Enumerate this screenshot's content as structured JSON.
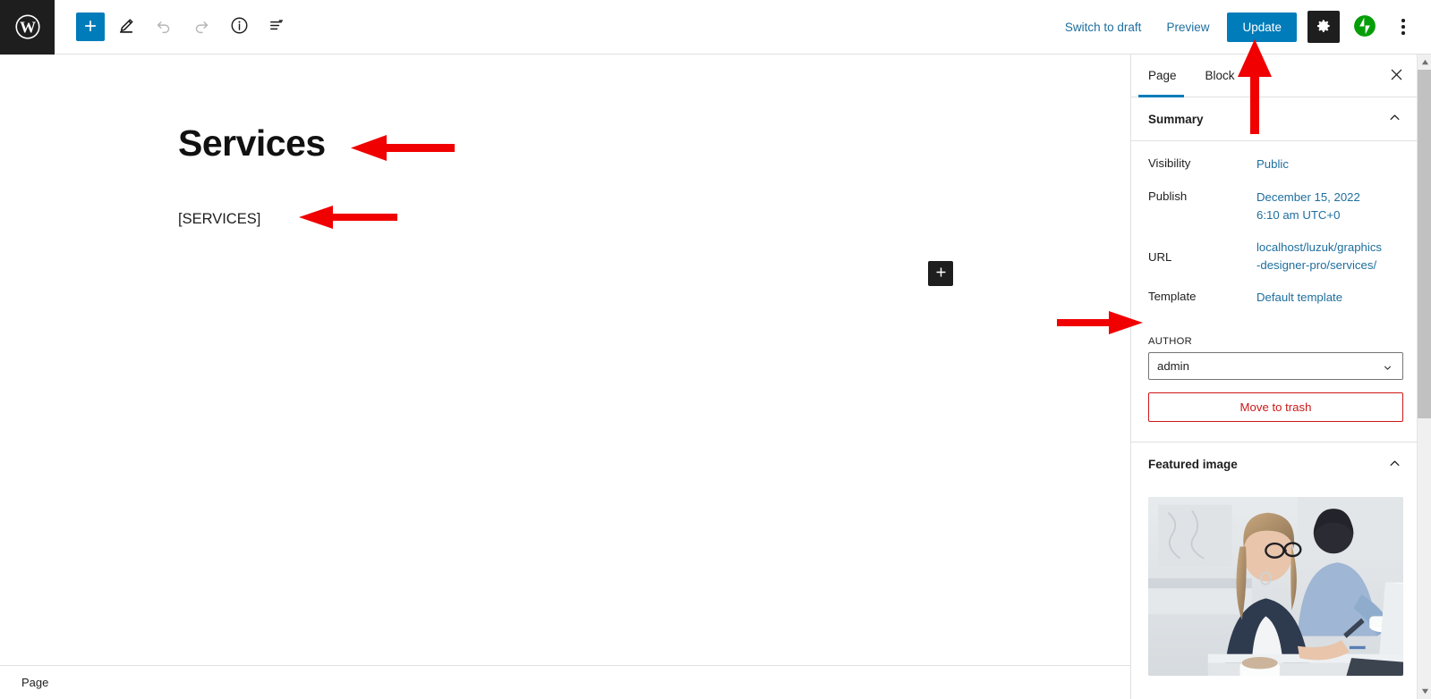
{
  "toolbar": {
    "logo_icon": "wordpress-logo-icon",
    "add_block_label": "+",
    "add_block_icon": "plus-icon",
    "tools_icon": "pencil-edit-icon",
    "undo_icon": "undo-arrow-icon",
    "redo_icon": "redo-arrow-icon",
    "details_icon": "info-circle-icon",
    "list_view_icon": "document-overview-icon",
    "switch_to_draft_label": "Switch to draft",
    "preview_label": "Preview",
    "update_label": "Update",
    "settings_icon": "gear-icon",
    "jetpack_icon": "jetpack-icon",
    "options_icon": "kebab-menu-icon"
  },
  "canvas": {
    "title": "Services",
    "body_text": "[SERVICES]",
    "inserter_icon": "plus-icon"
  },
  "statusbar": {
    "document_type": "Page"
  },
  "sidebar": {
    "tabs": [
      {
        "label": "Page",
        "active": true
      },
      {
        "label": "Block",
        "active": false
      }
    ],
    "close_icon": "close-x-icon",
    "summary": {
      "title": "Summary",
      "collapse_icon": "chevron-up-icon",
      "rows": [
        {
          "key": "Visibility",
          "value": "Public"
        },
        {
          "key": "Publish",
          "value": "December 15, 2022 6:10 am UTC+0"
        },
        {
          "key": "URL",
          "value": "localhost/luzuk/graphics-designer-pro/services/"
        },
        {
          "key": "Template",
          "value": "Default template"
        }
      ],
      "author_label": "AUTHOR",
      "author_value": "admin",
      "author_chevron_icon": "chevron-down-icon",
      "trash_label": "Move to trash"
    },
    "featured_image": {
      "title": "Featured image",
      "collapse_icon": "chevron-up-icon",
      "image_alt": "Two people working at desks with laptops in a bright office"
    },
    "scrollbar": {
      "up_icon": "scroll-up-arrow-icon",
      "down_icon": "scroll-down-arrow-icon"
    }
  },
  "annotations": {
    "color": "#f00000",
    "arrows": [
      {
        "name": "arrow-to-title",
        "direction": "left"
      },
      {
        "name": "arrow-to-body-shortcode",
        "direction": "left"
      },
      {
        "name": "arrow-to-template-row",
        "direction": "right"
      },
      {
        "name": "arrow-to-update-button",
        "direction": "up"
      }
    ]
  },
  "colors": {
    "accent_blue": "#007cba",
    "link_blue": "#1e6e9e",
    "dark": "#1e1e1e",
    "danger_red": "#cc1818",
    "annotation_red": "#f00000"
  }
}
